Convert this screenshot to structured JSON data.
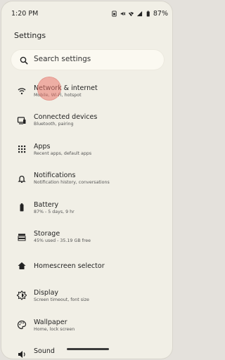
{
  "status_bar": {
    "time": "1:20 PM",
    "battery": "87%",
    "icons": [
      "sim-icon",
      "mute-icon",
      "wifi-icon",
      "signal-icon",
      "battery-icon"
    ]
  },
  "page": {
    "title": "Settings"
  },
  "search": {
    "placeholder": "Search settings",
    "icon": "search-icon"
  },
  "items": [
    {
      "label": "Network & internet",
      "sub": "Mobile, Wi-Fi, hotspot",
      "icon": "wifi-icon"
    },
    {
      "label": "Connected devices",
      "sub": "Bluetooth, pairing",
      "icon": "devices-icon"
    },
    {
      "label": "Apps",
      "sub": "Recent apps, default apps",
      "icon": "apps-grid-icon"
    },
    {
      "label": "Notifications",
      "sub": "Notification history, conversations",
      "icon": "bell-icon"
    },
    {
      "label": "Battery",
      "sub": "87% - 5 days, 9 hr",
      "icon": "battery-icon"
    },
    {
      "label": "Storage",
      "sub": "45% used - 35.19 GB free",
      "icon": "storage-icon"
    },
    {
      "label": "Homescreen selector",
      "sub": "",
      "icon": "home-icon"
    },
    {
      "label": "Display",
      "sub": "Screen timeout, font size",
      "icon": "brightness-icon"
    },
    {
      "label": "Wallpaper",
      "sub": "Home, lock screen",
      "icon": "palette-icon"
    },
    {
      "label": "Sound",
      "sub": "",
      "icon": "sound-icon"
    }
  ],
  "colors": {
    "background": "#f1efe6",
    "search_bg": "#fbf9f1",
    "touch_indicator": "#eb786e"
  }
}
